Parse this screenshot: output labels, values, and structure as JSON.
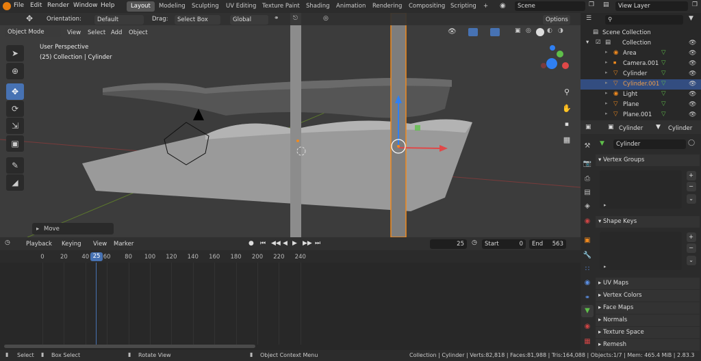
{
  "menubar": {
    "items": [
      "File",
      "Edit",
      "Render",
      "Window",
      "Help"
    ]
  },
  "workspaces": [
    "Layout",
    "Modeling",
    "Sculpting",
    "UV Editing",
    "Texture Paint",
    "Shading",
    "Animation",
    "Rendering",
    "Compositing",
    "Scripting"
  ],
  "add_ws": "+",
  "scene": "Scene",
  "view_layer": "View Layer",
  "toolbar": {
    "orientation_label": "Orientation:",
    "orientation": "Default",
    "drag_label": "Drag:",
    "drag": "Select Box",
    "transform": "Global",
    "options": "Options"
  },
  "viewport_header": {
    "mode": "Object Mode",
    "menus": [
      "View",
      "Select",
      "Add",
      "Object"
    ]
  },
  "viewport": {
    "title": "User Perspective",
    "subtitle": "(25) Collection | Cylinder",
    "operator": "Move"
  },
  "outliner": {
    "root": "Scene Collection",
    "collection": "Collection",
    "items": [
      {
        "name": "Area",
        "sel": false
      },
      {
        "name": "Camera.001",
        "sel": false
      },
      {
        "name": "Cylinder",
        "sel": false
      },
      {
        "name": "Cylinder.001",
        "sel": true
      },
      {
        "name": "Light",
        "sel": false
      },
      {
        "name": "Plane",
        "sel": false
      },
      {
        "name": "Plane.001",
        "sel": false
      }
    ]
  },
  "properties": {
    "object": "Cylinder",
    "data": "Cylinder",
    "mesh_name": "Cylinder",
    "sections_open": [
      "Vertex Groups",
      "Shape Keys"
    ],
    "sections_closed": [
      "UV Maps",
      "Vertex Colors",
      "Face Maps",
      "Normals",
      "Texture Space",
      "Remesh"
    ]
  },
  "timeline": {
    "menus": [
      "Playback",
      "Keying",
      "View",
      "Marker"
    ],
    "current": "25",
    "start_label": "Start",
    "start": "0",
    "end_label": "End",
    "end": "563",
    "ticks": [
      "0",
      "20",
      "40",
      "60",
      "80",
      "100",
      "120",
      "140",
      "160",
      "180",
      "200",
      "220",
      "240"
    ],
    "playhead": "25"
  },
  "statusbar": {
    "select": "Select",
    "box_select": "Box Select",
    "rotate": "Rotate View",
    "context": "Object Context Menu",
    "stats": "Collection | Cylinder | Verts:82,818 | Faces:81,988 | Tris:164,088 | Objects:1/7 | Mem: 465.4 MiB | 2.83.3"
  },
  "colors": {
    "accent": "#4772b3",
    "selected_outline": "#f28a1d",
    "active_row": "#334d80"
  }
}
